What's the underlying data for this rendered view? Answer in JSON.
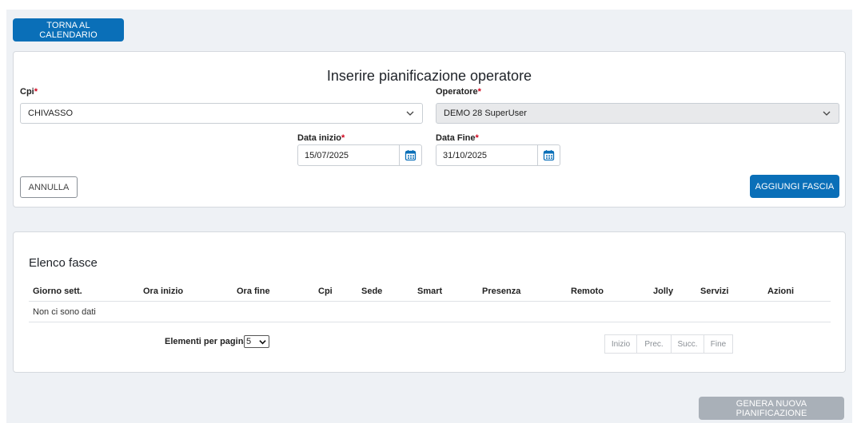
{
  "header": {
    "back_label": "TORNA AL CALENDARIO"
  },
  "form": {
    "title": "Inserire pianificazione operatore",
    "cpi": {
      "label": "Cpi",
      "required_mark": "*",
      "value": "CHIVASSO"
    },
    "operatore": {
      "label": "Operatore",
      "required_mark": "*",
      "value": "DEMO 28 SuperUser",
      "disabled": true
    },
    "data_inizio": {
      "label": "Data inizio",
      "required_mark": "*",
      "value": "15/07/2025"
    },
    "data_fine": {
      "label": "Data Fine",
      "required_mark": "*",
      "value": "31/10/2025"
    },
    "cancel_label": "ANNULLA",
    "add_label": "AGGIUNGI FASCIA"
  },
  "list": {
    "title": "Elenco fasce",
    "columns": [
      "Giorno sett.",
      "Ora inizio",
      "Ora fine",
      "Cpi",
      "Sede",
      "Smart",
      "Presenza",
      "Remoto",
      "Jolly",
      "Servizi",
      "Azioni"
    ],
    "empty_text": "Non ci sono dati",
    "per_page_label": "Elementi per pagina",
    "per_page_value": "5",
    "pager": [
      "Inizio",
      "Prec.",
      "Succ.",
      "Fine"
    ]
  },
  "footer": {
    "generate_label": "GENERA NUOVA PIANIFICAZIONE"
  },
  "colors": {
    "primary": "#0a6fb8",
    "required": "#d0021b",
    "disabled_button": "#a9b0b8"
  },
  "icons": {
    "select_arrow": "chevron-down-icon",
    "date_picker": "calendar-icon"
  }
}
